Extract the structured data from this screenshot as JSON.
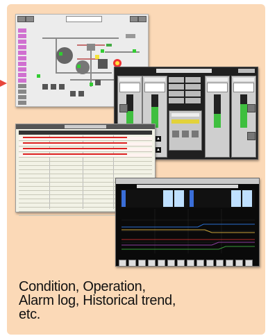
{
  "caption": {
    "line1": "Condition, Operation,",
    "line2": "Alarm log, Historical trend,",
    "line3": "etc."
  },
  "screens": [
    {
      "icon": "plant-diagram-screenshot"
    },
    {
      "icon": "operation-panel-screenshot"
    },
    {
      "icon": "alarm-log-screenshot"
    },
    {
      "icon": "historical-trend-screenshot"
    }
  ],
  "colors": {
    "panel_background": "#fbd9b7",
    "arrow": "#e8463a",
    "alarm_text": "#dd2222",
    "gauge_fill": "#3fbf3f"
  }
}
